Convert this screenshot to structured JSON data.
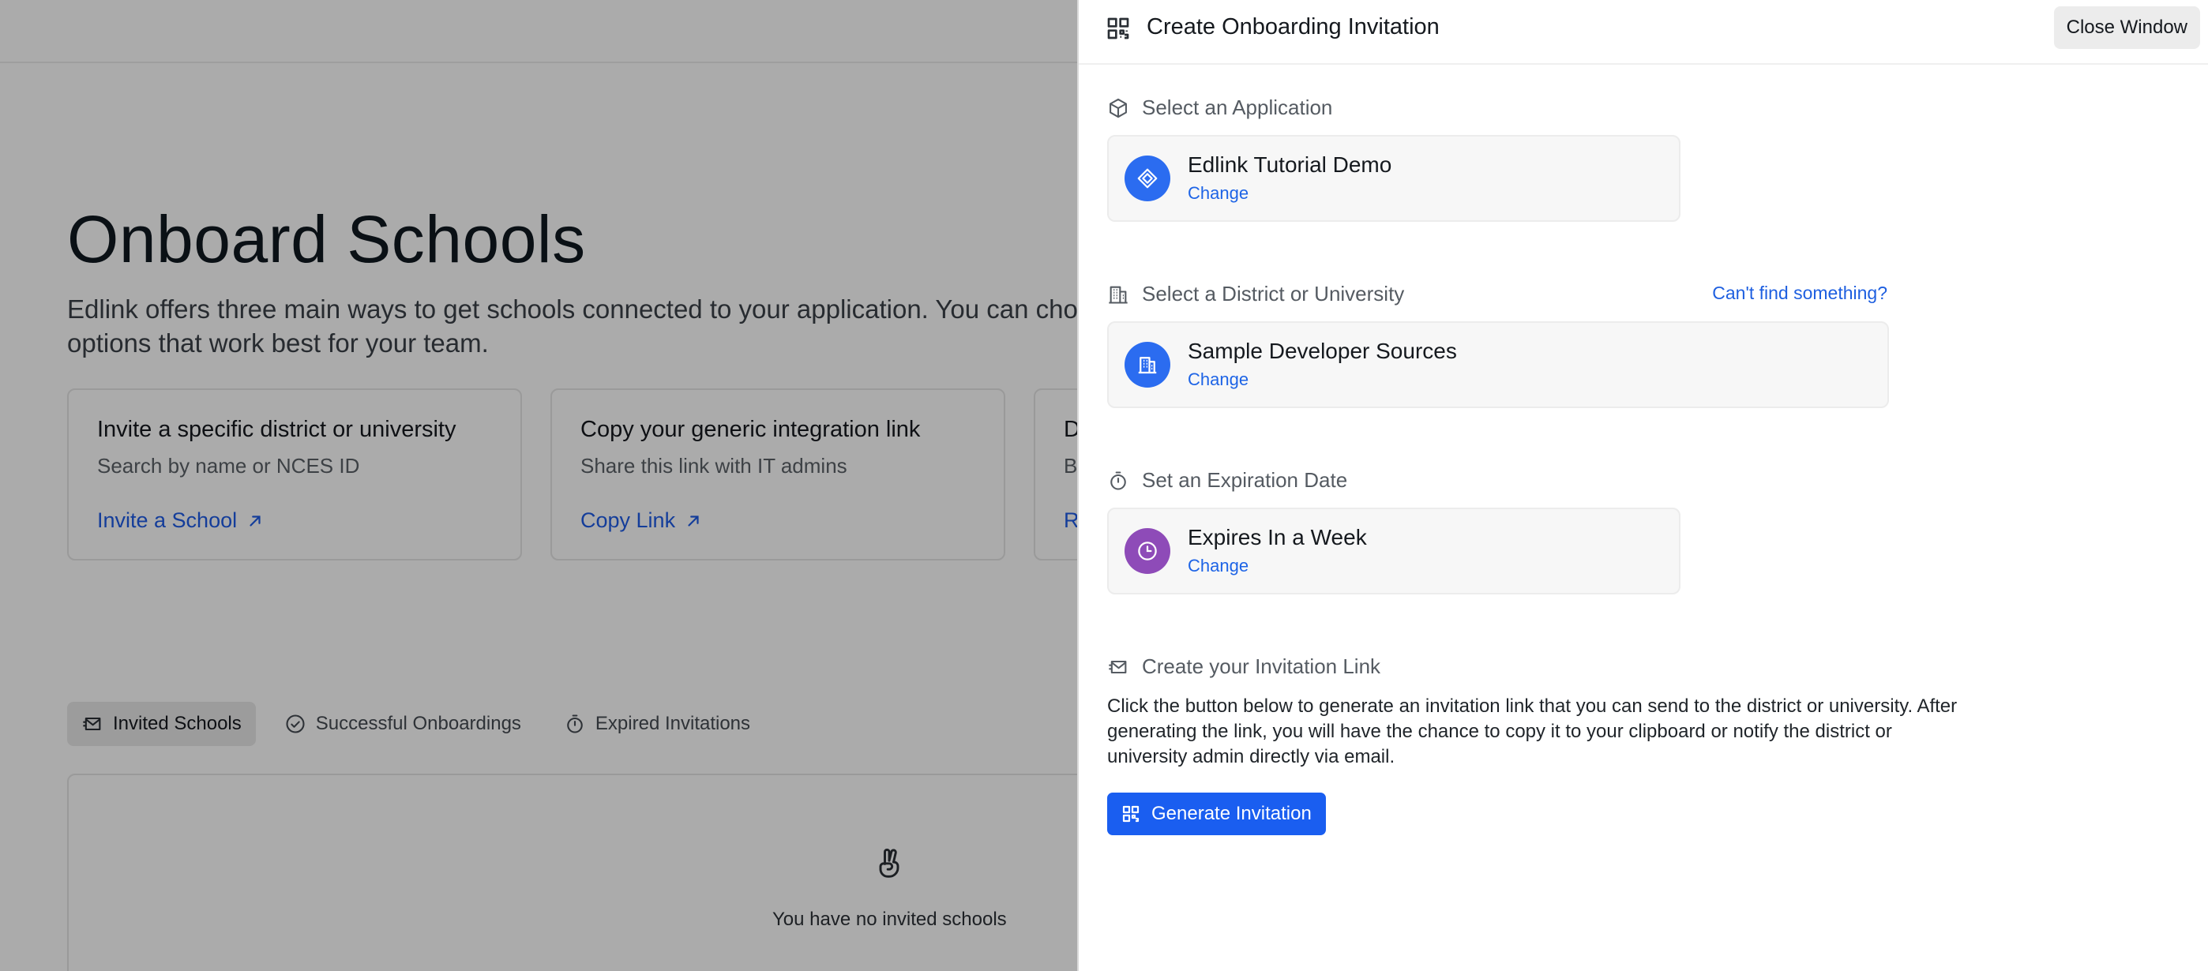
{
  "background": {
    "title": "Onboard Schools",
    "description": "Edlink offers three main ways to get schools connected to your application. You can choose the option or options that work best for your team.",
    "cards": [
      {
        "title": "Invite a specific district or university",
        "subtitle": "Search by name or NCES ID",
        "link": "Invite a School"
      },
      {
        "title": "Copy your generic integration link",
        "subtitle": "Share this link with IT admins",
        "link": "Copy Link"
      },
      {
        "title": "D",
        "subtitle": "B",
        "link": "R"
      }
    ],
    "tabs": [
      {
        "label": "Invited Schools",
        "icon": "envelope-icon",
        "active": true
      },
      {
        "label": "Successful Onboardings",
        "icon": "check-circle-icon",
        "active": false
      },
      {
        "label": "Expired Invitations",
        "icon": "stopwatch-icon",
        "active": false
      }
    ],
    "empty_message": "You have no invited schools"
  },
  "drawer": {
    "title": "Create Onboarding Invitation",
    "close_label": "Close Window",
    "application": {
      "label": "Select an Application",
      "name": "Edlink Tutorial Demo",
      "change": "Change"
    },
    "district": {
      "label": "Select a District or University",
      "cant_find": "Can't find something?",
      "name": "Sample Developer Sources",
      "change": "Change"
    },
    "expiration": {
      "label": "Set an Expiration Date",
      "name": "Expires In a Week",
      "change": "Change"
    },
    "invitation": {
      "label": "Create your Invitation Link",
      "help": "Click the button below to generate an invitation link that you can send to the district or university. After generating the link, you will have the chance to copy it to your clipboard or notify the district or university admin directly via email.",
      "button": "Generate Invitation"
    }
  },
  "colors": {
    "accent": "#1a5ef0",
    "link": "#1e64e6",
    "purple_avatar": "#8e4bb8",
    "blue_avatar": "#2b6cf0"
  }
}
